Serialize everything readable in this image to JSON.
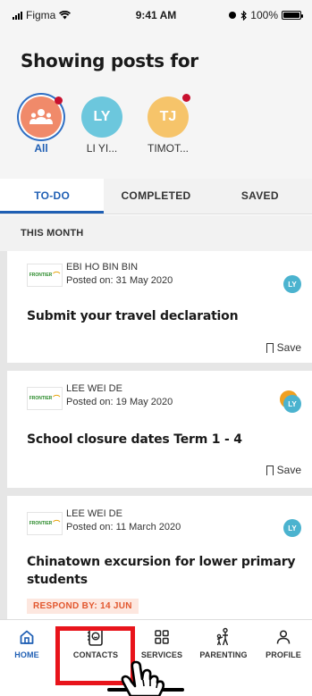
{
  "status_bar": {
    "carrier": "Figma",
    "time": "9:41 AM",
    "battery": "100%"
  },
  "header": {
    "title": "Showing posts for",
    "filters": [
      {
        "label": "All",
        "initials": "",
        "active": true,
        "unread": true
      },
      {
        "label": "LI YI...",
        "initials": "LY",
        "active": false,
        "unread": false
      },
      {
        "label": "TIMOT...",
        "initials": "TJ",
        "active": false,
        "unread": true
      }
    ]
  },
  "tabs": [
    {
      "label": "TO-DO",
      "active": true
    },
    {
      "label": "COMPLETED",
      "active": false
    },
    {
      "label": "SAVED",
      "active": false
    }
  ],
  "section_header": "THIS MONTH",
  "posts": [
    {
      "sender": "EBI HO BIN BIN",
      "posted": "Posted on: 31 May 2020",
      "title": "Submit your travel declaration",
      "avatar": "LY",
      "save_label": "Save",
      "logo": "FRONTIER"
    },
    {
      "sender": "LEE WEI DE",
      "posted": "Posted on: 19 May 2020",
      "title": "School closure dates Term 1 - 4",
      "avatar": "LY",
      "save_label": "Save",
      "logo": "FRONTIER"
    },
    {
      "sender": "LEE WEI DE",
      "posted": "Posted on: 11 March 2020",
      "title_line1": "Chinatown excursion for lower primary",
      "title_line2": "students",
      "avatar": "LY",
      "respond_by": "RESPOND BY: 14 JUN",
      "logo": "FRONTIER"
    }
  ],
  "nav": [
    {
      "label": "HOME",
      "icon": "home-icon",
      "active": true
    },
    {
      "label": "CONTACTS",
      "icon": "contacts-icon",
      "active": false
    },
    {
      "label": "SERVICES",
      "icon": "services-grid-icon",
      "active": false
    },
    {
      "label": "PARENTING",
      "icon": "parenting-icon",
      "active": false
    },
    {
      "label": "PROFILE",
      "icon": "profile-icon",
      "active": false
    }
  ],
  "colors": {
    "accent": "#1f5fb4",
    "highlight": "#e8141b",
    "respond": "#e2572e",
    "unread_dot": "#c8102e"
  }
}
